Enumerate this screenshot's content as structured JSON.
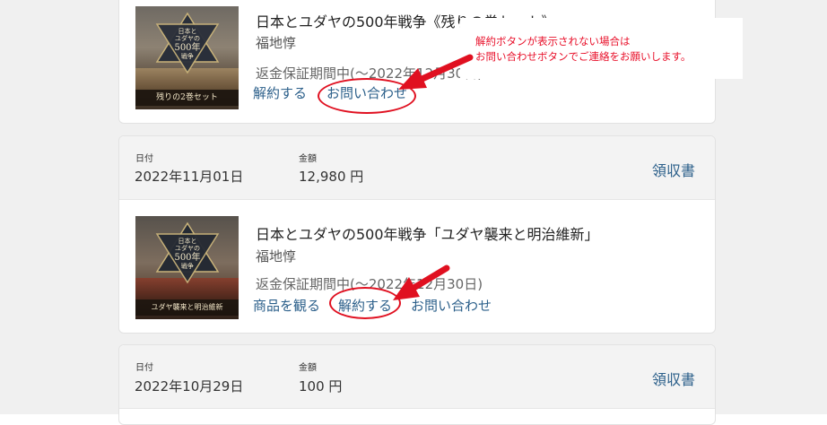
{
  "note": {
    "line1": "解約ボタンが表示されない場合は",
    "line2": "お問い合わせボタンでご連絡をお願いします。"
  },
  "orders": [
    {
      "item": {
        "title": "日本とユダヤの500年戦争《残りの巻セット》",
        "author": "福地惇",
        "guarantee": "返金保証期間中(〜2022年12月30日)",
        "cancel_label": "解約する",
        "contact_label": "お問い合わせ",
        "thumb_band": "残りの2巻セット",
        "thumb_cover": [
          "日本と",
          "ユダヤの",
          "500年",
          "戦争"
        ]
      }
    },
    {
      "date_label": "日付",
      "date": "2022年11月01日",
      "amount_label": "金額",
      "amount": "12,980 円",
      "receipt_label": "領収書",
      "item": {
        "title": "日本とユダヤの500年戦争「ユダヤ襲来と明治維新」",
        "author": "福地惇",
        "guarantee": "返金保証期間中(〜2022年12月30日)",
        "watch_label": "商品を観る",
        "cancel_label": "解約する",
        "contact_label": "お問い合わせ",
        "thumb_band": "ユダヤ襲来と明治維新",
        "thumb_cover": [
          "日本と",
          "ユダヤの",
          "500年",
          "戦争"
        ]
      }
    },
    {
      "date_label": "日付",
      "date": "2022年10月29日",
      "amount_label": "金額",
      "amount": "100 円",
      "receipt_label": "領収書"
    }
  ],
  "colors": {
    "link": "#2b5f8a",
    "annotation": "#e01020",
    "note_text": "#e8102a"
  }
}
